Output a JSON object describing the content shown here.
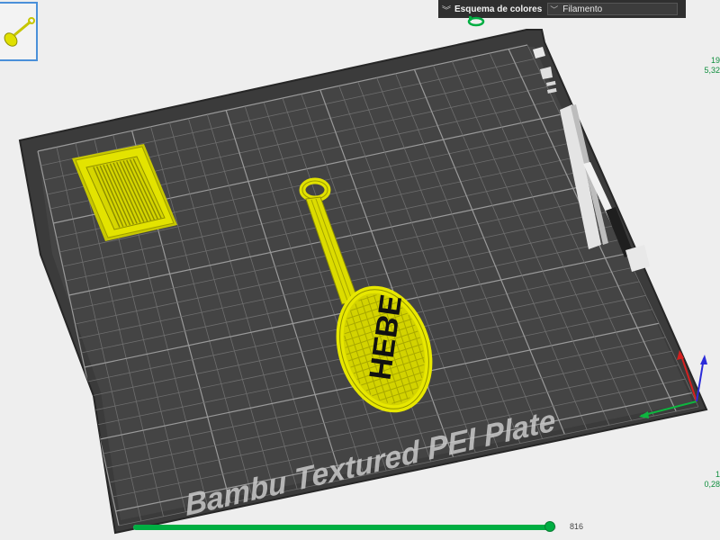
{
  "color_scheme": {
    "title": "Esquema de colores",
    "selected": "Filamento",
    "collapse_icon": "double-chevron-down-icon",
    "dropdown_icon": "chevron-down-icon"
  },
  "plate": {
    "label": "Bambu Textured PEI Plate",
    "object_text": "HEBE"
  },
  "layers": {
    "top_layer": "19",
    "top_height": "5,32",
    "bottom_layer": "1",
    "bottom_height": "0,28"
  },
  "move_slider": {
    "value_label": "816",
    "fraction": 0.985
  },
  "colors": {
    "accent": "#00ae42",
    "filament": "#e6e600",
    "plate": "#3a3a3a",
    "background": "#eeeeee"
  }
}
